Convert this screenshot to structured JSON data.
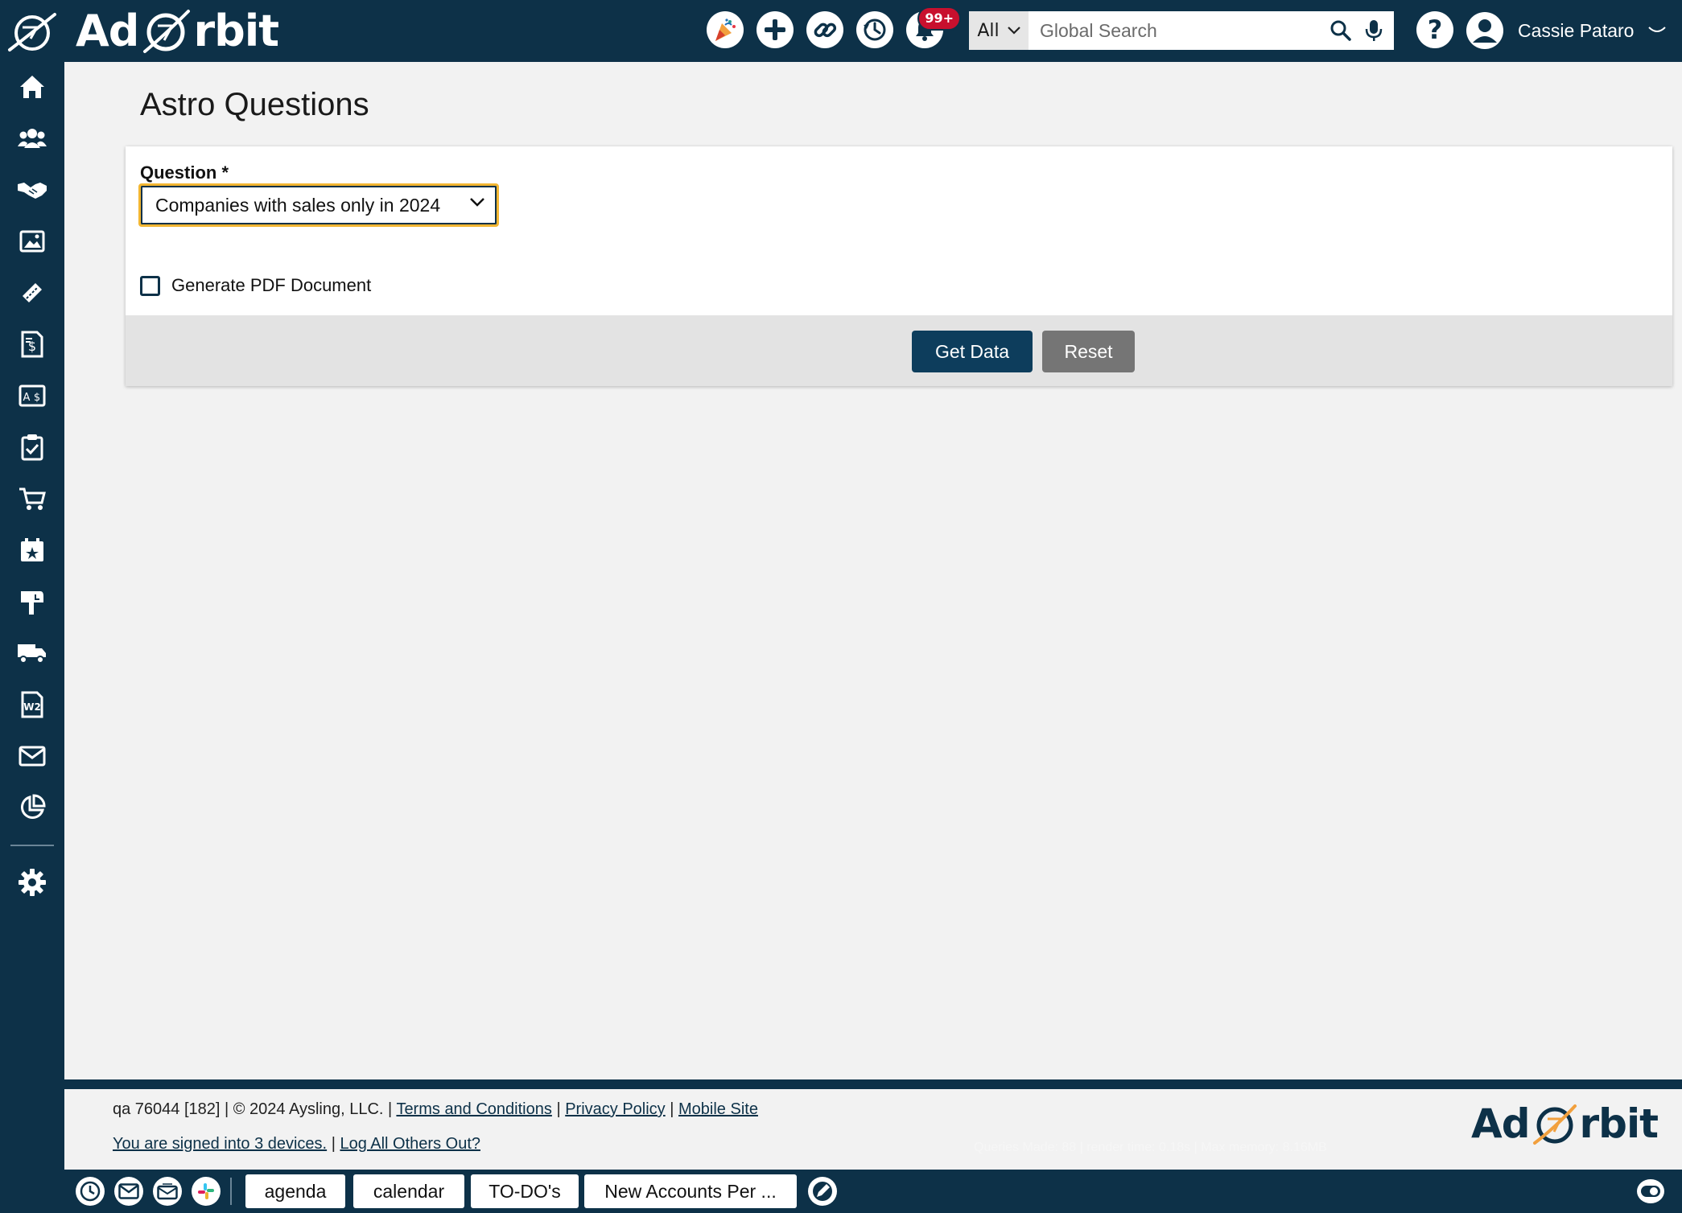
{
  "app": {
    "brand": "AdOrbit",
    "brand_prefix": "Ad",
    "brand_suffix": "rbit"
  },
  "topbar": {
    "icons": [
      "party-icon",
      "plus-icon",
      "link-icon",
      "history-icon",
      "bell-icon"
    ],
    "notification_badge": "99+",
    "search": {
      "scope": "All",
      "placeholder": "Global Search"
    },
    "help": "?",
    "user_name": "Cassie Pataro"
  },
  "sidebar": {
    "items": [
      "home-icon",
      "contacts-icon",
      "deals-icon",
      "media-icon",
      "tickets-icon",
      "invoice-icon",
      "billing-icon",
      "tasks-icon",
      "cart-icon",
      "events-icon",
      "mailbox-icon",
      "delivery-icon",
      "w2-icon",
      "mail-icon",
      "reports-icon",
      "settings-icon"
    ]
  },
  "page": {
    "title": "Astro Questions",
    "question_label": "Question *",
    "question_value": "Companies with sales only in 2024",
    "pdf_label": "Generate PDF Document",
    "pdf_checked": false,
    "get_data_label": "Get Data",
    "reset_label": "Reset"
  },
  "footer": {
    "build": "qa 76044 [182] | © 2024 Aysling, LLC. |",
    "terms": "Terms and Conditions",
    "sep1": "|",
    "privacy": "Privacy Policy",
    "sep2": "|",
    "mobile": "Mobile Site",
    "devices": "You are signed into 3 devices.",
    "sep3": "|",
    "logout_others": "Log All Others Out?",
    "perf": "Queries Made: 88 | render time: 0.18s | Max memory: 8.16MB"
  },
  "dock": {
    "icons": [
      "clock-icon",
      "email-icon",
      "email-open-icon",
      "slack-icon"
    ],
    "tabs": [
      "agenda",
      "calendar",
      "TO-DO's",
      "New Accounts Per ..."
    ]
  },
  "colors": {
    "navy": "#0d3148",
    "primary_button": "#0d3d5c",
    "secondary_button": "#757575",
    "focus_outline": "#f2b632",
    "badge": "#c8102e",
    "logo_accent": "#f2a03d"
  }
}
